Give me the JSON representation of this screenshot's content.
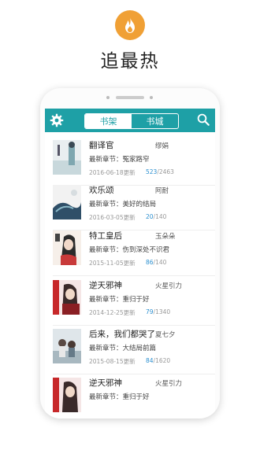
{
  "promo": {
    "title": "追最热",
    "icon": "flame-icon",
    "icon_color": "#f0a035"
  },
  "app": {
    "accent_color": "#1ea0a6",
    "tabs": [
      {
        "label": "书架",
        "active": true
      },
      {
        "label": "书城",
        "active": false
      }
    ],
    "settings_icon": "gear-icon",
    "search_icon": "search-icon"
  },
  "books": [
    {
      "title": "翻译官",
      "author": "缪娟",
      "chapter": "最新章节：冤家路窄",
      "date": "2016-06-18更新",
      "current": "523",
      "total": "/2463"
    },
    {
      "title": "欢乐颂",
      "author": "阿耐",
      "chapter": "最新章节：美好的结局",
      "date": "2016-03-05更新",
      "current": "20",
      "total": "/140"
    },
    {
      "title": "特工皇后",
      "author": "玉朵朵",
      "chapter": "最新章节：伤到深处不识君",
      "date": "2015-11-05更新",
      "current": "86",
      "total": "/140"
    },
    {
      "title": "逆天邪神",
      "author": "火星引力",
      "chapter": "最新章节：重归于好",
      "date": "2014-12-25更新",
      "current": "79",
      "total": "/1340"
    },
    {
      "title": "后来，我们都哭了",
      "author": "夏七夕",
      "chapter": "最新章节：大结局前篇",
      "date": "2015-08-15更新",
      "current": "84",
      "total": "/1620"
    },
    {
      "title": "逆天邪神",
      "author": "火星引力",
      "chapter": "最新章节：重归于好",
      "date": "",
      "current": "",
      "total": ""
    }
  ]
}
